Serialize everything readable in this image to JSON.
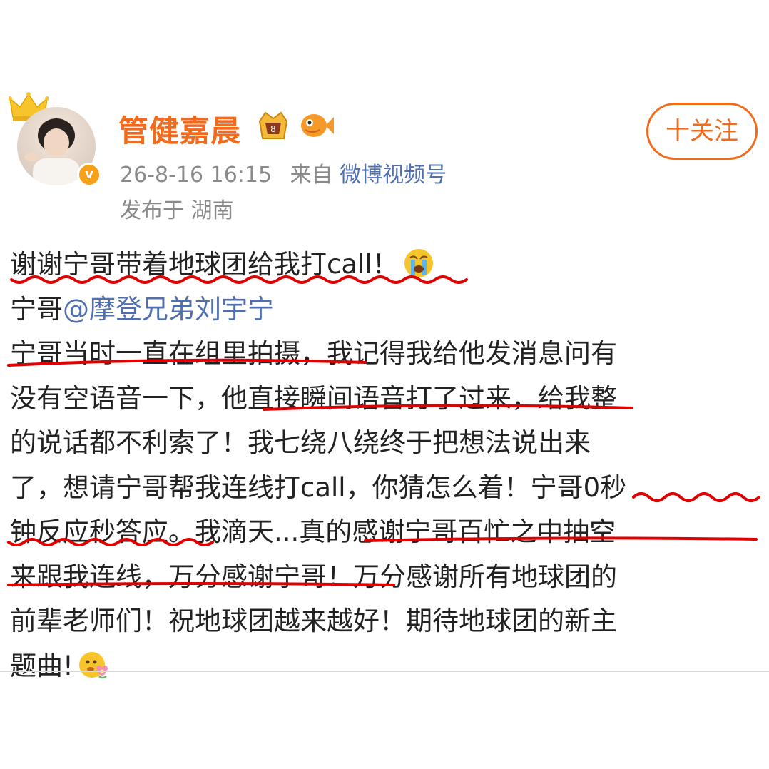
{
  "user": {
    "name": "管健嘉晨",
    "verified_mark": "v",
    "avatar_alt": "avatar"
  },
  "follow_button": {
    "label": "十关注"
  },
  "meta": {
    "time": "26-8-16 16:15",
    "source_prefix": "来自",
    "source": "微博视频号",
    "location": "发布于 湖南"
  },
  "post": {
    "l1": "谢谢宁哥带着地球团给我打call！",
    "l2a": "宁哥",
    "l2b": "@摩登兄弟刘宇宁",
    "l3": "宁哥当时一直在组里拍摄，我记得我给他发消息问有",
    "l4": "没有空语音一下，他直接瞬间语音打了过来，给我整",
    "l5": "的说话都不利索了！我七绕八绕终于把想法说出来",
    "l6": "了，想请宁哥帮我连线打call，你猜怎么着！宁哥0秒",
    "l7": "钟反应秒答应。我滴天...真的感谢宁哥百忙之中抽空",
    "l8": "来跟我连线，万分感谢宁哥！万分感谢所有地球团的",
    "l9": "前辈老师们！祝地球团越来越好！期待地球团的新主",
    "l10": "题曲!"
  },
  "icons": {
    "crown": "crown-icon",
    "badge1": "vip-badge-icon",
    "badge2": "fish-badge-icon",
    "cry": "crying-emoji-icon",
    "flower": "flower-emoji-icon"
  },
  "colors": {
    "username": "#f26a1b",
    "link": "#4f6fb0",
    "meta": "#8a8a8a",
    "annotation": "#e00000"
  }
}
